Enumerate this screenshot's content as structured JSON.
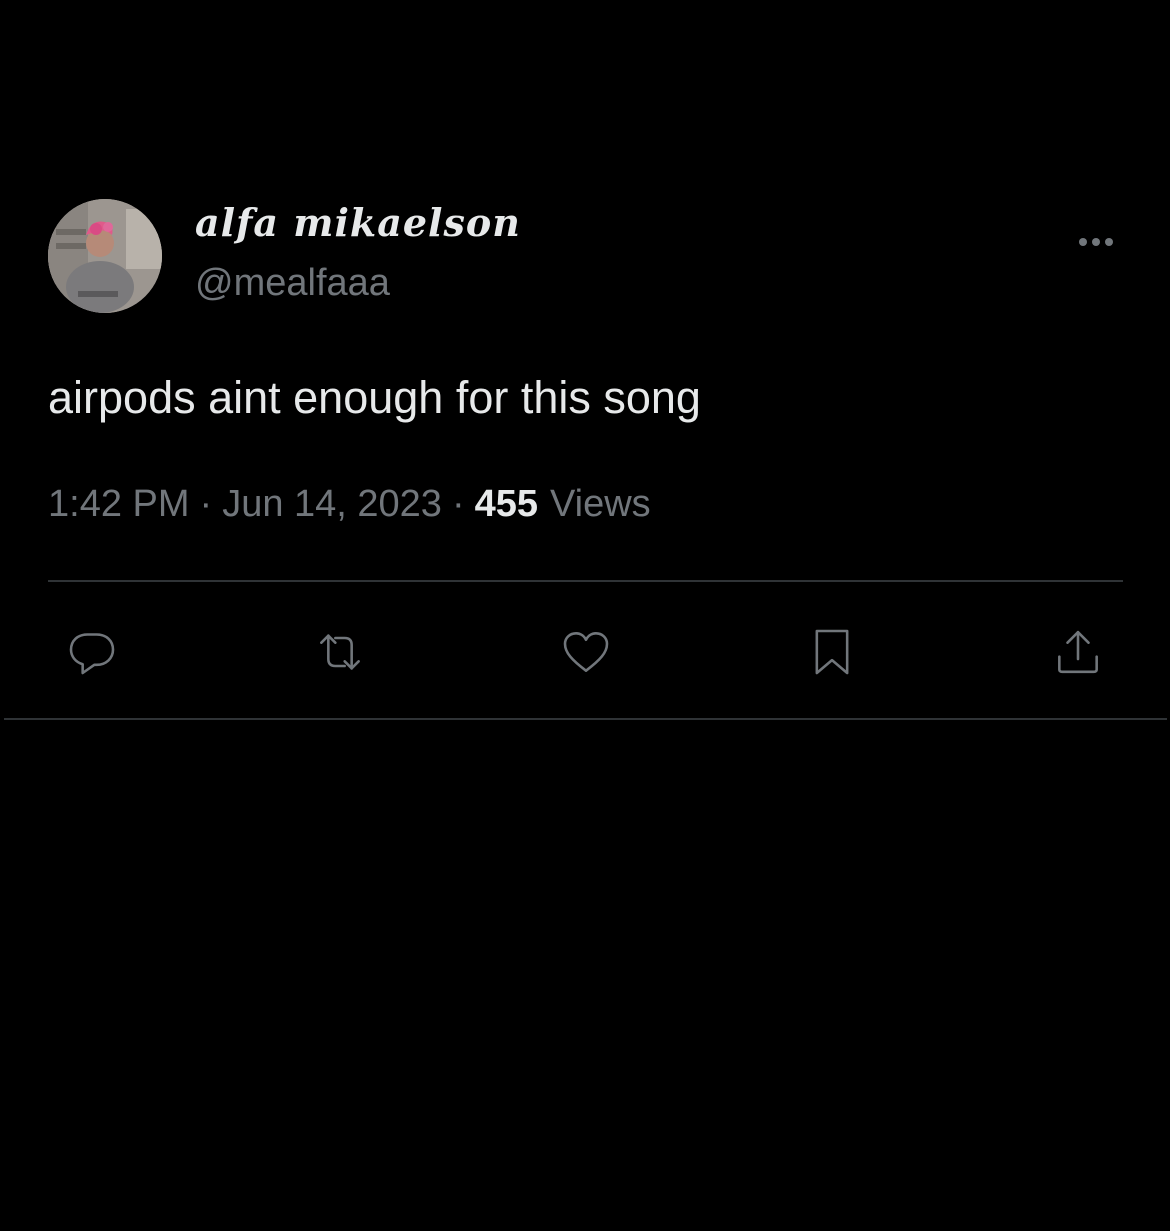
{
  "tweet": {
    "display_name": "alfa mikaelson",
    "handle": "@mealfaaa",
    "text": "airpods aint enough for this song",
    "time": "1:42 PM",
    "separator": "·",
    "date": "Jun 14, 2023",
    "views_count": "455",
    "views_label": "Views"
  },
  "icons": {
    "more": "more-horizontal-icon",
    "reply": "reply-icon",
    "retweet": "retweet-icon",
    "like": "heart-icon",
    "bookmark": "bookmark-icon",
    "share": "share-icon"
  },
  "colors": {
    "background": "#000000",
    "primary_text": "#e7e9ea",
    "secondary_text": "#71767b",
    "divider": "#2f3336"
  }
}
